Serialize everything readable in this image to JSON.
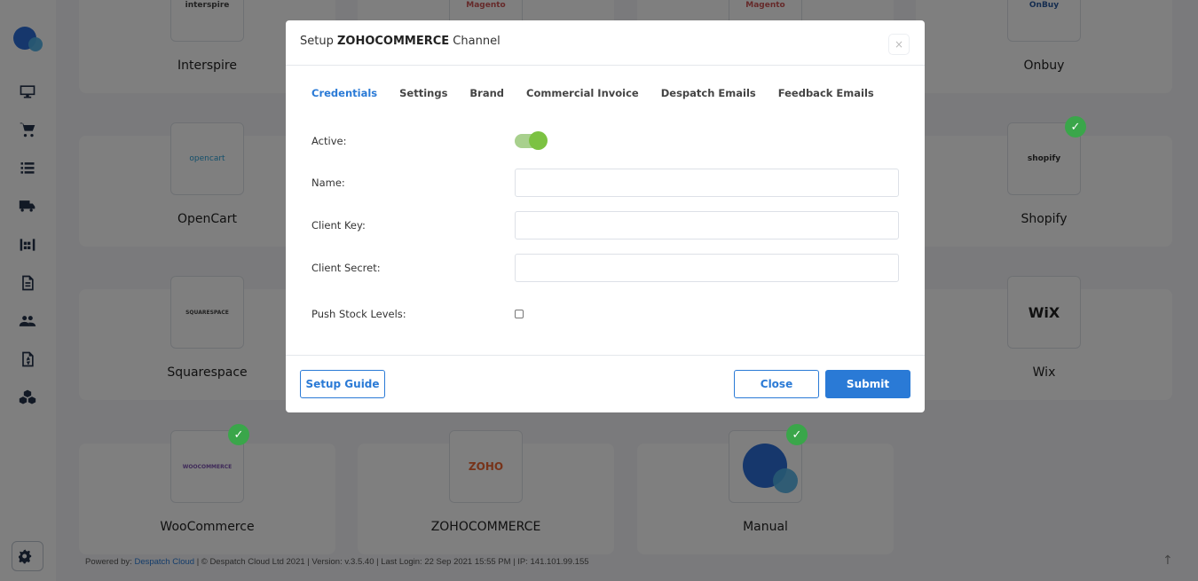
{
  "background": {
    "channels": [
      {
        "name": "Interspire",
        "logo_text": "interspire",
        "checked": false
      },
      {
        "name": "Onbuy",
        "logo_text": "OnBuy",
        "checked": false
      },
      {
        "name": "OpenCart",
        "logo_text": "opencart",
        "checked": false
      },
      {
        "name": "Shopify",
        "logo_text": "shopify",
        "checked": true
      },
      {
        "name": "Squarespace",
        "logo_text": "SQUARESPACE",
        "checked": false
      },
      {
        "name": "Wix",
        "logo_text": "WiX",
        "checked": false
      },
      {
        "name": "WooCommerce",
        "logo_text": "WOOCOMMERCE",
        "checked": true
      },
      {
        "name": "ZOHOCOMMERCE",
        "logo_text": "ZOHO",
        "checked": false
      },
      {
        "name": "Manual",
        "logo_text": "",
        "checked": true
      },
      {
        "name": "",
        "logo_text": "Magento",
        "checked": false
      },
      {
        "name": "",
        "logo_text": "Magento",
        "checked": false
      }
    ],
    "footer": {
      "powered_by": "Powered by:",
      "brand_link": "Despatch Cloud",
      "rest": " | © Despatch Cloud Ltd 2021 | Version: v.3.5.40 | Last Login: 22 Sep 2021 15:55 PM | IP: 141.101.99.155"
    },
    "check_mark": "✓",
    "up_arrow": "↑"
  },
  "modal": {
    "title_prefix": "Setup ",
    "title_channel": "ZOHOCOMMERCE",
    "title_suffix": " Channel",
    "close_glyph": "×",
    "tabs": [
      "Credentials",
      "Settings",
      "Brand",
      "Commercial Invoice",
      "Despatch Emails",
      "Feedback Emails"
    ],
    "active_tab": "Credentials",
    "fields": {
      "active_label": "Active:",
      "active_value": true,
      "name_label": "Name:",
      "name_value": "",
      "client_key_label": "Client Key:",
      "client_key_value": "",
      "client_secret_label": "Client Secret:",
      "client_secret_value": "",
      "push_stock_label": "Push Stock Levels:",
      "push_stock_value": false
    },
    "buttons": {
      "setup_guide": "Setup Guide",
      "close": "Close",
      "submit": "Submit"
    }
  },
  "colors": {
    "accent": "#2a7ad6",
    "check": "#3aa64a",
    "toggle": "#7cc242"
  }
}
